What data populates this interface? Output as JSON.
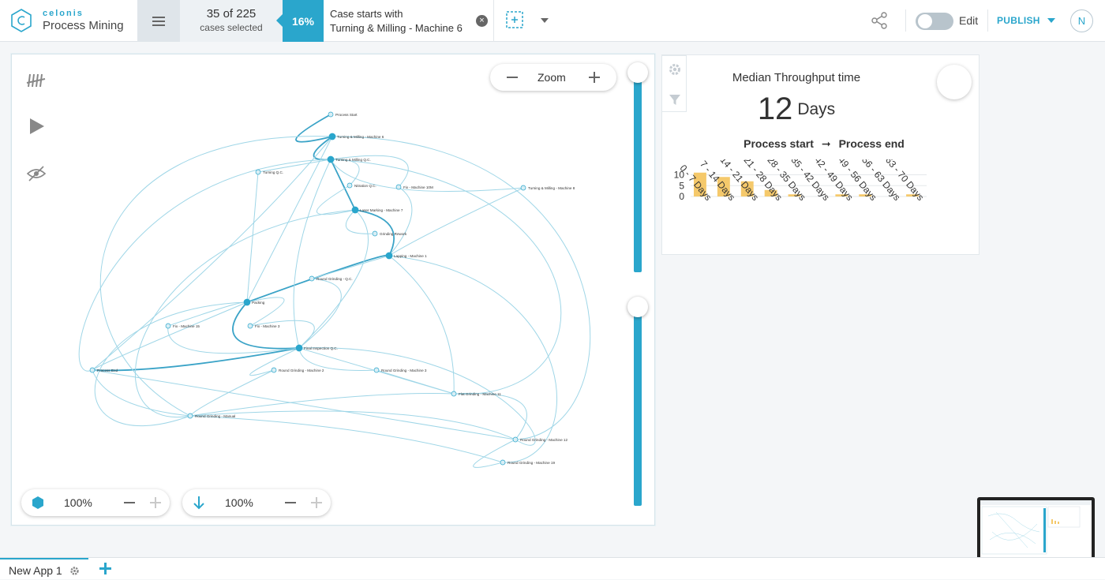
{
  "brand": {
    "name": "celonis",
    "product": "Process Mining"
  },
  "selection": {
    "count_text": "35 of 225",
    "sub_text": "cases selected",
    "percent": "16%"
  },
  "filter": {
    "line1": "Case starts with",
    "line2": "Turning & Milling - Machine 6"
  },
  "toolbar": {
    "edit_label": "Edit",
    "publish_label": "PUBLISH",
    "avatar_initial": "N",
    "edit_enabled": false
  },
  "explorer": {
    "zoom_label": "Zoom",
    "activities_value": "100%",
    "connections_value": "100%",
    "activity_slider_level": 0,
    "connection_slider_level": 0
  },
  "process_map": {
    "nodes": [
      "Process Start",
      "Turning & Milling - Machine 6",
      "Turning & Milling Q.C.",
      "Turning Q.C.",
      "Nitration Q.C.",
      "Fix - Machine 10M",
      "Turning & Milling - Machine 8",
      "Laser Marking - Machine 7",
      "Grinding Rework",
      "Lapping - Machine 1",
      "Round Grinding - Q.C.",
      "Packing",
      "Fix - Machine 15",
      "Fix - Machine 3",
      "Final Inspection Q.C.",
      "Process End",
      "Round Grinding - Machine 2",
      "Round Grinding - Machine 3",
      "Flat Grinding - Machine 11",
      "Round Grinding - Manual",
      "Round Grinding - Machine 12",
      "Round Grinding - Machine 19"
    ]
  },
  "kpi": {
    "title": "Median Throughput time",
    "value": "12",
    "unit": "Days",
    "range_from": "Process start",
    "range_arrow": "➞",
    "range_to": "Process end"
  },
  "chart_data": {
    "type": "bar",
    "categories": [
      "0 - 7 Days",
      "7 - 14 Days",
      "14 - 21 Days",
      "21 - 28 Days",
      "28 - 35 Days",
      "35 - 42 Days",
      "42 - 49 Days",
      "49 - 56 Days",
      "56 - 63 Days",
      "63 - 70 Days"
    ],
    "values": [
      11,
      9,
      7,
      3,
      1,
      0,
      1,
      1,
      0,
      1
    ],
    "ylim": [
      0,
      12
    ],
    "yticks": [
      "10",
      "5",
      "0"
    ],
    "bar_color": "#f5c96b",
    "grid": true
  },
  "tabs": {
    "active_label": "New App 1"
  },
  "colors": {
    "accent": "#2aa6cc",
    "bar": "#f5c96b"
  }
}
